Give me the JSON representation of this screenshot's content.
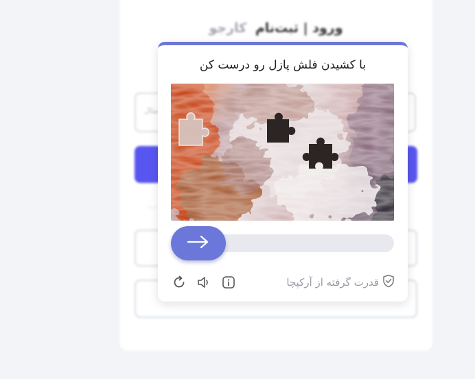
{
  "background": {
    "title_main": "ورود | ثبت‌نام",
    "title_brand": "کارجو",
    "input_placeholder": "مثال"
  },
  "captcha": {
    "instruction": "با کشیدن فلش پازل رو درست کن",
    "powered_by": "قدرت گرفته از آرکپچا",
    "icons": {
      "refresh": "refresh-icon",
      "audio": "speaker-icon",
      "info": "info-icon",
      "shield": "shield-check-icon",
      "arrow": "arrow-right-icon"
    },
    "slider_progress": 0,
    "accent_color": "#6b78da"
  }
}
